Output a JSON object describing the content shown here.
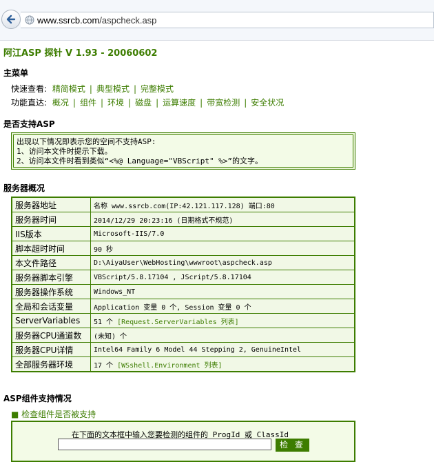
{
  "browser": {
    "url_host": "www.ssrcb.com",
    "url_path": "/aspcheck.asp"
  },
  "page": {
    "title": "阿江ASP 探针 V 1.93 - 20060602"
  },
  "main_menu": {
    "heading": "主菜单",
    "quick_view_label": "快速查看:",
    "quick_view_links": [
      "精简模式",
      "典型模式",
      "完整模式"
    ],
    "function_label": "功能直达:",
    "function_links": [
      "概况",
      "组件",
      "环境",
      "磁盘",
      "运算速度",
      "带宽检测",
      "安全状况"
    ]
  },
  "asp_support": {
    "heading": "是否支持ASP",
    "lines": [
      "出现以下情况即表示您的空间不支持ASP:",
      "1、访问本文件时提示下载。",
      "2、访问本文件时看到类似“<%@ Language=\"VBScript\" %>”的文字。"
    ]
  },
  "server_overview": {
    "heading": "服务器概况",
    "rows": [
      {
        "key": "服务器地址",
        "value": "名称 www.ssrcb.com(IP:42.121.117.128) 端口:80"
      },
      {
        "key": "服务器时间",
        "value": "2014/12/29 20:23:16 (日期格式不规范)"
      },
      {
        "key": "IIS版本",
        "value": "Microsoft-IIS/7.0"
      },
      {
        "key": "脚本超时时间",
        "value": "90 秒"
      },
      {
        "key": "本文件路径",
        "value": "D:\\AiyaUser\\WebHosting\\wwwroot\\aspcheck.asp"
      },
      {
        "key": "服务器脚本引擎",
        "value": "VBScript/5.8.17104 , JScript/5.8.17104"
      },
      {
        "key": "服务器操作系统",
        "value": "Windows_NT"
      },
      {
        "key": "全局和会话变量",
        "value": "Application 变量 0 个, Session 变量 0 个"
      },
      {
        "key": "ServerVariables",
        "value": "51 个 ",
        "link": "[Request.ServerVariables 列表]"
      },
      {
        "key": "服务器CPU通道数",
        "value": "(未知) 个"
      },
      {
        "key": "服务器CPU详情",
        "value": "Intel64 Family 6 Model 44 Stepping 2, GenuineIntel"
      },
      {
        "key": "全部服务器环境",
        "value": "17 个 ",
        "link": "[WSshell.Environment 列表]"
      }
    ]
  },
  "components": {
    "heading": "ASP组件支持情况",
    "sub_heading": "■ 检查组件是否被支持",
    "prompt": "在下面的文本框中输入您要检测的组件的 ProgId 或 ClassId",
    "input_value": "",
    "button_label": "检 查"
  },
  "colors": {
    "accent": "#3d7d00",
    "box_bg": "#f3fbe7"
  }
}
